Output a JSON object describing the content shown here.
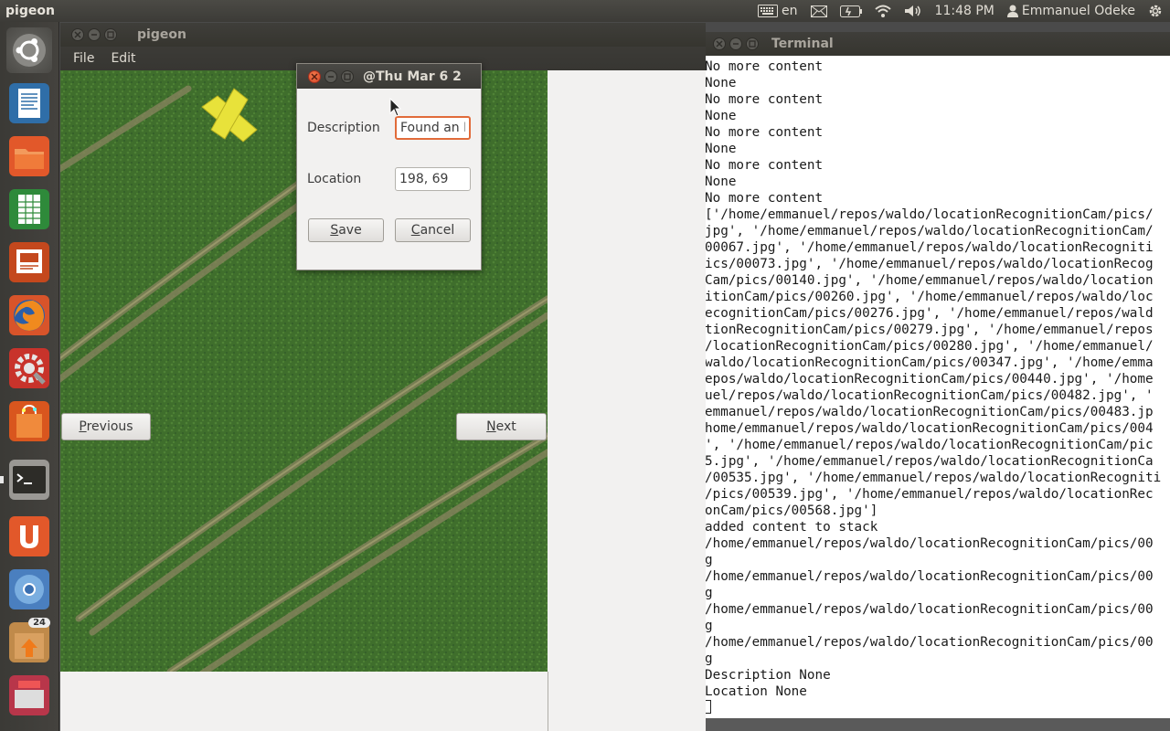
{
  "top_panel": {
    "app_name": "pigeon",
    "language": "en",
    "time": "11:48 PM",
    "user": "Emmanuel Odeke",
    "icons": [
      "keyboard-icon",
      "mail-icon",
      "battery-icon",
      "wifi-icon",
      "volume-icon",
      "user-icon",
      "gear-icon"
    ]
  },
  "launcher": {
    "items": [
      {
        "name": "ubuntu-dash"
      },
      {
        "name": "libreoffice-writer"
      },
      {
        "name": "files"
      },
      {
        "name": "libreoffice-calc"
      },
      {
        "name": "libreoffice-impress"
      },
      {
        "name": "firefox"
      },
      {
        "name": "system-settings"
      },
      {
        "name": "software-center"
      },
      {
        "name": "terminal"
      },
      {
        "name": "ubuntu-one"
      },
      {
        "name": "chromium"
      },
      {
        "name": "software-updater",
        "badge": "24"
      },
      {
        "name": "workspace-switcher"
      }
    ]
  },
  "pigeon": {
    "title": "pigeon",
    "menu": [
      "File",
      "Edit"
    ],
    "prev_label_first": "P",
    "prev_label_rest": "revious",
    "next_label_first": "N",
    "next_label_rest": "ext"
  },
  "dialog": {
    "title": "@Thu Mar  6 2",
    "description_label": "Description",
    "description_value": "Found an E!",
    "location_label": "Location",
    "location_value": "198, 69",
    "save_first": "S",
    "save_rest": "ave",
    "cancel_first": "C",
    "cancel_rest": "ancel"
  },
  "terminal": {
    "title": "Terminal",
    "lines": [
      "No more content",
      "None",
      "No more content",
      "None",
      "No more content",
      "None",
      "No more content",
      "None",
      "No more content",
      "['/home/emmanuel/repos/waldo/locationRecognitionCam/pics/",
      "jpg', '/home/emmanuel/repos/waldo/locationRecognitionCam/",
      "00067.jpg', '/home/emmanuel/repos/waldo/locationRecogniti",
      "ics/00073.jpg', '/home/emmanuel/repos/waldo/locationRecog",
      "Cam/pics/00140.jpg', '/home/emmanuel/repos/waldo/location",
      "itionCam/pics/00260.jpg', '/home/emmanuel/repos/waldo/loc",
      "ecognitionCam/pics/00276.jpg', '/home/emmanuel/repos/wald",
      "tionRecognitionCam/pics/00279.jpg', '/home/emmanuel/repos",
      "/locationRecognitionCam/pics/00280.jpg', '/home/emmanuel/",
      "waldo/locationRecognitionCam/pics/00347.jpg', '/home/emma",
      "epos/waldo/locationRecognitionCam/pics/00440.jpg', '/home",
      "uel/repos/waldo/locationRecognitionCam/pics/00482.jpg', '",
      "emmanuel/repos/waldo/locationRecognitionCam/pics/00483.jp",
      "home/emmanuel/repos/waldo/locationRecognitionCam/pics/004",
      "', '/home/emmanuel/repos/waldo/locationRecognitionCam/pic",
      "5.jpg', '/home/emmanuel/repos/waldo/locationRecognitionCa",
      "/00535.jpg', '/home/emmanuel/repos/waldo/locationRecogniti",
      "/pics/00539.jpg', '/home/emmanuel/repos/waldo/locationRec",
      "onCam/pics/00568.jpg']",
      "added content to stack",
      "/home/emmanuel/repos/waldo/locationRecognitionCam/pics/00",
      "g",
      "/home/emmanuel/repos/waldo/locationRecognitionCam/pics/00",
      "g",
      "/home/emmanuel/repos/waldo/locationRecognitionCam/pics/00",
      "g",
      "/home/emmanuel/repos/waldo/locationRecognitionCam/pics/00",
      "g",
      "Description None",
      "Location None"
    ]
  },
  "colors": {
    "panel_bg": "#3c3b37",
    "accent_orange": "#e16b3a",
    "close_button": "#d9482b",
    "field_green": "#3f6e2c",
    "target_yellow": "#e8e23a"
  }
}
